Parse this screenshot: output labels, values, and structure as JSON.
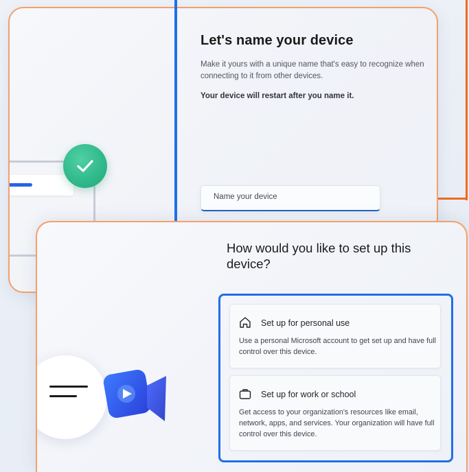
{
  "name_device": {
    "title": "Let's name your device",
    "description": "Make it yours with a unique name that's easy to recognize when connecting to it from other devices.",
    "restart_notice": "Your device will restart after you name it.",
    "input_placeholder": "Name your device"
  },
  "setup": {
    "title": "How would you like to set up this device?",
    "options": [
      {
        "icon": "home-icon",
        "label": "Set up for personal use",
        "description": "Use a personal Microsoft account to get set up and have full control over this device."
      },
      {
        "icon": "briefcase-icon",
        "label": "Set up for work or school",
        "description": "Get access to your organization's resources like email, network, apps, and services. Your organization will have full control over this device."
      }
    ]
  },
  "colors": {
    "accent_blue": "#1f6fe8",
    "accent_orange": "#ef6a1c",
    "success_green": "#2fb889"
  }
}
